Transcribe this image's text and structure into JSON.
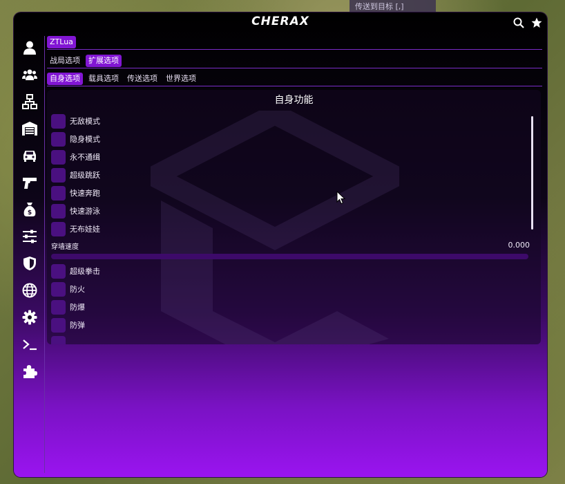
{
  "hud": {
    "tip": "传送到目标 [,]"
  },
  "titlebar": {
    "logo": "CHERAX"
  },
  "breadcrumb": {
    "label": "ZTLua"
  },
  "tabs_level1": [
    {
      "label": "战局选项",
      "active": false
    },
    {
      "label": "扩展选项",
      "active": true
    }
  ],
  "tabs_level2": [
    {
      "label": "自身选项",
      "active": true
    },
    {
      "label": "载具选项",
      "active": false
    },
    {
      "label": "传送选项",
      "active": false
    },
    {
      "label": "世界选项",
      "active": false
    }
  ],
  "panel": {
    "title": "自身功能",
    "options_top": [
      "无敌模式",
      "隐身模式",
      "永不通缉",
      "超级跳跃",
      "快速奔跑",
      "快速游泳",
      "无布娃娃"
    ],
    "slider": {
      "label": "穿墙速度",
      "value": "0.000",
      "fill_fraction": 0
    },
    "options_bottom": [
      "超级拳击",
      "防火",
      "防爆",
      "防弹"
    ]
  },
  "colors": {
    "accent": "#8216d4",
    "checkbox": "#4a1080"
  },
  "sidebar_icons": [
    "user-icon",
    "users-icon",
    "network-icon",
    "garage-icon",
    "car-icon",
    "gun-icon",
    "money-bag-icon",
    "sliders-icon",
    "shield-icon",
    "globe-icon",
    "gear-icon",
    "terminal-icon",
    "puzzle-icon"
  ]
}
